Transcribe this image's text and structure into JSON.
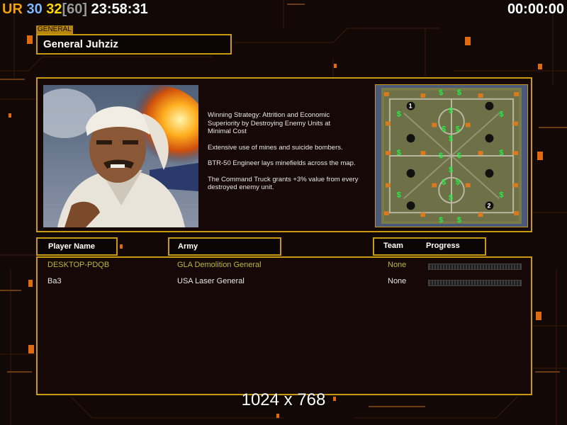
{
  "hud": {
    "ur_label": "UR",
    "fps_a": "30",
    "fps_b": "32",
    "fps_limit": "[60]",
    "clock": "23:58:31",
    "timer": "00:00:00"
  },
  "general": {
    "tag": "GENERAL",
    "name": "General Juhziz"
  },
  "description": [
    "Winning Strategy: Attrition and Economic\n Superiority by Destroying Enemy Units at\n Minimal Cost",
    "Extensive use of mines and suicide bombers.",
    "BTR-50 Engineer lays minefields across the map.",
    "The Command Truck grants +3% value from every\n destroyed enemy unit."
  ],
  "columns": {
    "player_name": "Player Name",
    "army": "Army",
    "team": "Team",
    "progress": "Progress"
  },
  "players": [
    {
      "name": "DESKTOP-PDQB",
      "army": "GLA Demolition General",
      "team": "None",
      "progress": 0,
      "color": "#b9b93a"
    },
    {
      "name": "Ba3",
      "army": "USA Laser General",
      "team": "None",
      "progress": 0,
      "color": "#e6e6e6"
    }
  ],
  "minimap": {
    "start_positions": [
      "1",
      "2"
    ],
    "supply_symbol": "$"
  },
  "resolution_label": "1024 x 768",
  "colors": {
    "accent": "#c89a12",
    "ur": "#f4a000",
    "fps_a": "#7fb8ff",
    "fps_b": "#ffd700",
    "fps_limit": "#999999"
  }
}
